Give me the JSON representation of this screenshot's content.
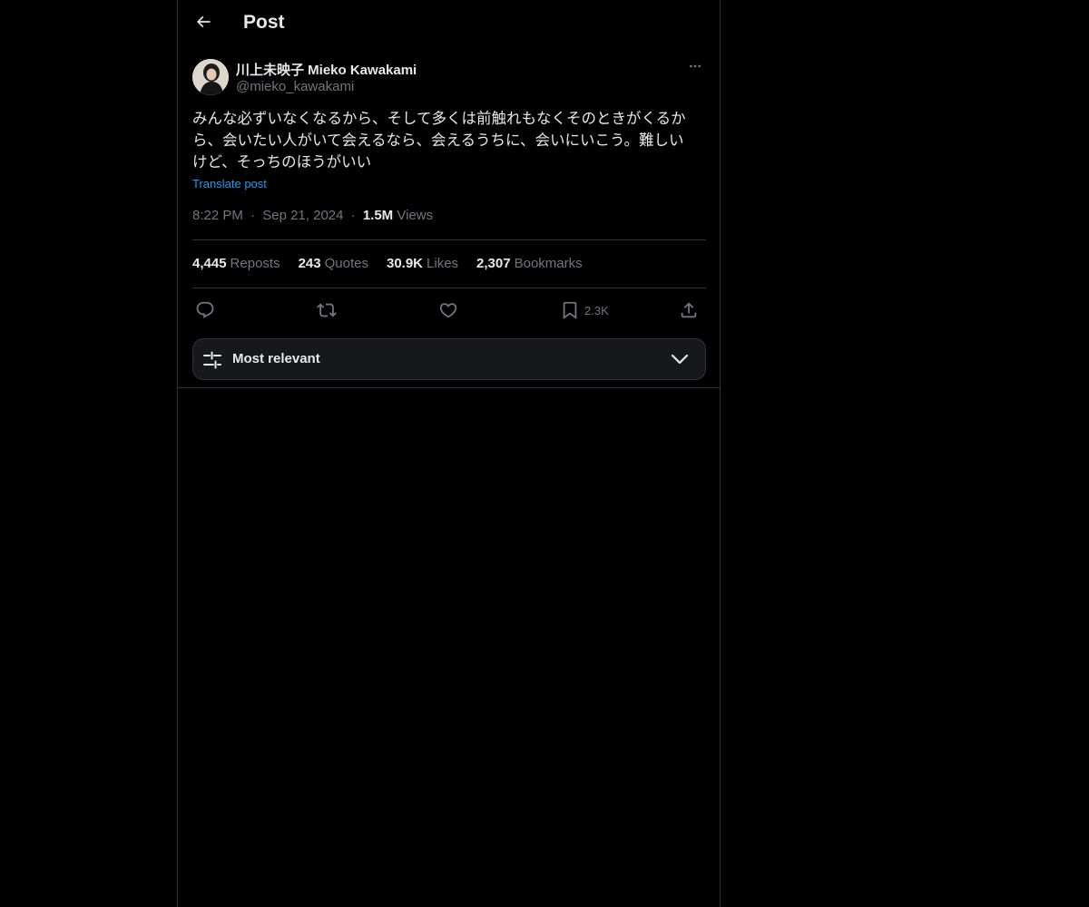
{
  "header": {
    "title": "Post"
  },
  "post": {
    "author": {
      "display_name": "川上未映子 Mieko Kawakami",
      "handle": "@mieko_kawakami"
    },
    "text_lines": [
      "みんな必ずいなくなるから、そして多くは前触れもなくそのときがくるか",
      "ら、会いたい人がいて会えるなら、会えるうちに、会いにいこう。難しい",
      "けど、そっちのほうがいい"
    ],
    "translate_label": "Translate post",
    "time": "8:22 PM",
    "date": "Sep 21, 2024",
    "views_count": "1.5M",
    "views_label": "Views",
    "separator": "·"
  },
  "stats": {
    "reposts_count": "4,445",
    "reposts_label": "Reposts",
    "quotes_count": "243",
    "quotes_label": "Quotes",
    "likes_count": "30.9K",
    "likes_label": "Likes",
    "bookmarks_count": "2,307",
    "bookmarks_label": "Bookmarks"
  },
  "actions": {
    "bookmark_count": "2.3K",
    "icons": [
      "reply-icon",
      "repost-icon",
      "like-icon",
      "bookmark-icon",
      "share-icon"
    ]
  },
  "replies_sort": {
    "label": "Most relevant"
  },
  "colors": {
    "background": "#000000",
    "text": "#e7e9ea",
    "secondary_text": "#71767b",
    "accent": "#1d9bf0",
    "border": "#2f3336"
  }
}
